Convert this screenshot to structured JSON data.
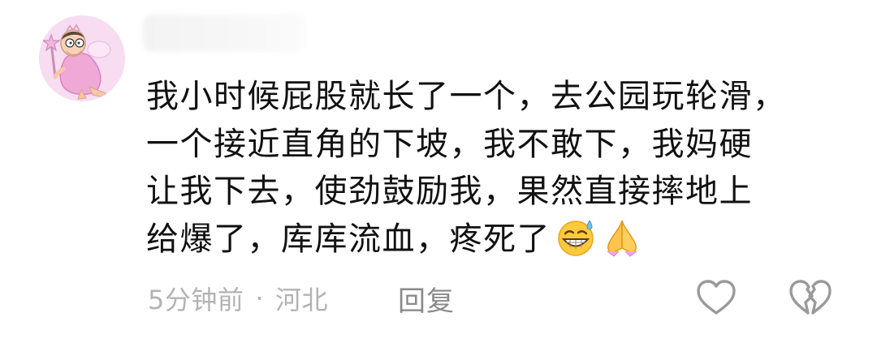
{
  "comment": {
    "avatar": "cartoon-character-avatar",
    "body_lines": [
      "我小时候屁股就长了一个，去公园玩轮滑，",
      "一个接近直角的下坡，我不敢下，我妈硬",
      "让我下去，使劲鼓励我，果然直接摔地上",
      "给爆了，库库流血，疼死了"
    ],
    "emojis": [
      "grinning-sweat-emoji",
      "folded-hands-emoji"
    ],
    "time": "5分钟前",
    "separator": "·",
    "location": "河北",
    "reply_label": "回复",
    "like_icon": "heart-outline-icon",
    "dislike_icon": "broken-heart-outline-icon"
  },
  "colors": {
    "text": "#111111",
    "meta": "#b3b3b3",
    "reply": "#8a8a8a",
    "avatar_bg": "#f7dcf2",
    "icon": "#9a9a9a"
  }
}
